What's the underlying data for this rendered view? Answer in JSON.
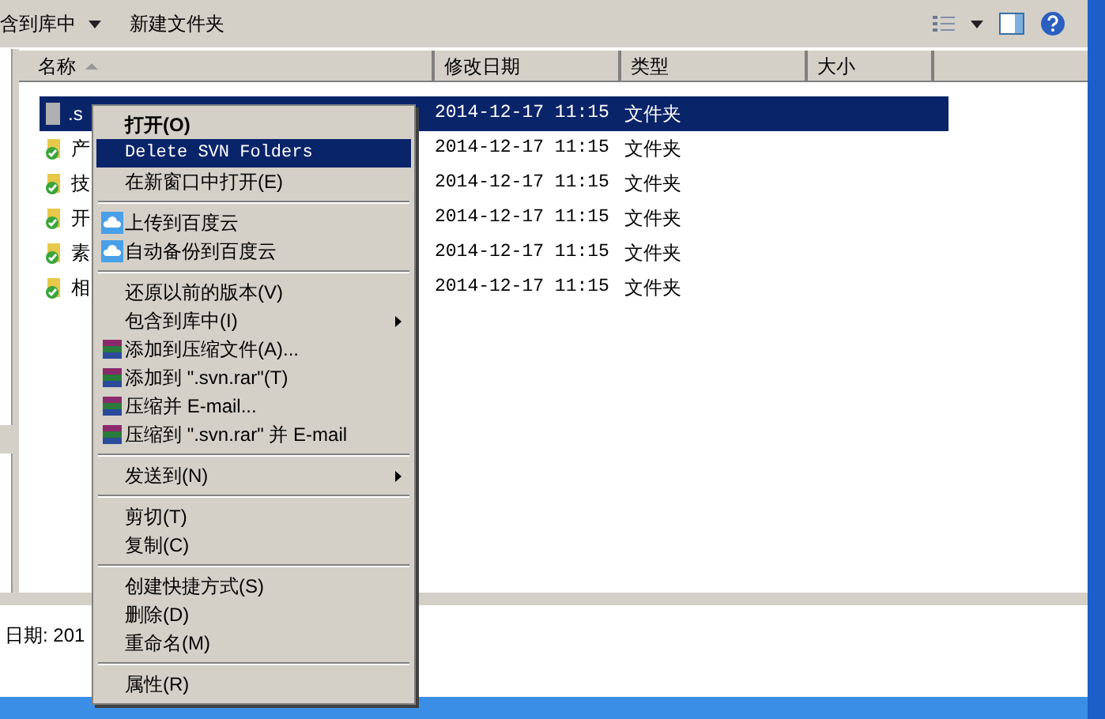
{
  "toolbar": {
    "include_in_library": "含到库中",
    "new_folder": "新建文件夹"
  },
  "columns": [
    {
      "label": "名称",
      "sorted": true
    },
    {
      "label": "修改日期",
      "sorted": false
    },
    {
      "label": "类型",
      "sorted": false
    },
    {
      "label": "大小",
      "sorted": false
    }
  ],
  "rows": [
    {
      "name": ".s",
      "date": "2014-12-17 11:15",
      "type": "文件夹",
      "selected": true,
      "kind": "plain"
    },
    {
      "name": "产",
      "date": "2014-12-17 11:15",
      "type": "文件夹",
      "selected": false,
      "kind": "svn"
    },
    {
      "name": "技",
      "date": "2014-12-17 11:15",
      "type": "文件夹",
      "selected": false,
      "kind": "svn"
    },
    {
      "name": "开",
      "date": "2014-12-17 11:15",
      "type": "文件夹",
      "selected": false,
      "kind": "svn"
    },
    {
      "name": "素",
      "date": "2014-12-17 11:15",
      "type": "文件夹",
      "selected": false,
      "kind": "svn"
    },
    {
      "name": "相",
      "date": "2014-12-17 11:15",
      "type": "文件夹",
      "selected": false,
      "kind": "svn"
    }
  ],
  "details": "日期: 201",
  "context_menu": [
    {
      "kind": "item",
      "label": "打开(O)",
      "bold": true,
      "selected": false
    },
    {
      "kind": "item",
      "label": "Delete SVN Folders",
      "bold": false,
      "selected": true,
      "mono": true
    },
    {
      "kind": "item",
      "label": "在新窗口中打开(E)",
      "bold": false,
      "selected": false
    },
    {
      "kind": "separator"
    },
    {
      "kind": "cloud-item",
      "label": "上传到百度云",
      "bold": false,
      "selected": false
    },
    {
      "kind": "cloud-item",
      "label": "自动备份到百度云",
      "bold": false,
      "selected": false
    },
    {
      "kind": "separator"
    },
    {
      "kind": "item",
      "label": "还原以前的版本(V)",
      "bold": false,
      "selected": false
    },
    {
      "kind": "item",
      "label": "包含到库中(I)",
      "bold": false,
      "selected": false,
      "submenu": true
    },
    {
      "kind": "archive-item",
      "label": "添加到压缩文件(A)...",
      "bold": false,
      "selected": false
    },
    {
      "kind": "archive-item",
      "label": "添加到 \".svn.rar\"(T)",
      "bold": false,
      "selected": false
    },
    {
      "kind": "archive-item",
      "label": "压缩并 E-mail...",
      "bold": false,
      "selected": false
    },
    {
      "kind": "archive-item",
      "label": "压缩到 \".svn.rar\" 并 E-mail",
      "bold": false,
      "selected": false
    },
    {
      "kind": "separator"
    },
    {
      "kind": "item",
      "label": "发送到(N)",
      "bold": false,
      "selected": false,
      "submenu": true
    },
    {
      "kind": "separator"
    },
    {
      "kind": "item",
      "label": "剪切(T)",
      "bold": false,
      "selected": false
    },
    {
      "kind": "item",
      "label": "复制(C)",
      "bold": false,
      "selected": false
    },
    {
      "kind": "separator"
    },
    {
      "kind": "item",
      "label": "创建快捷方式(S)",
      "bold": false,
      "selected": false
    },
    {
      "kind": "item",
      "label": "删除(D)",
      "bold": false,
      "selected": false
    },
    {
      "kind": "item",
      "label": "重命名(M)",
      "bold": false,
      "selected": false
    },
    {
      "kind": "separator"
    },
    {
      "kind": "item",
      "label": "属性(R)",
      "bold": false,
      "selected": false
    }
  ]
}
